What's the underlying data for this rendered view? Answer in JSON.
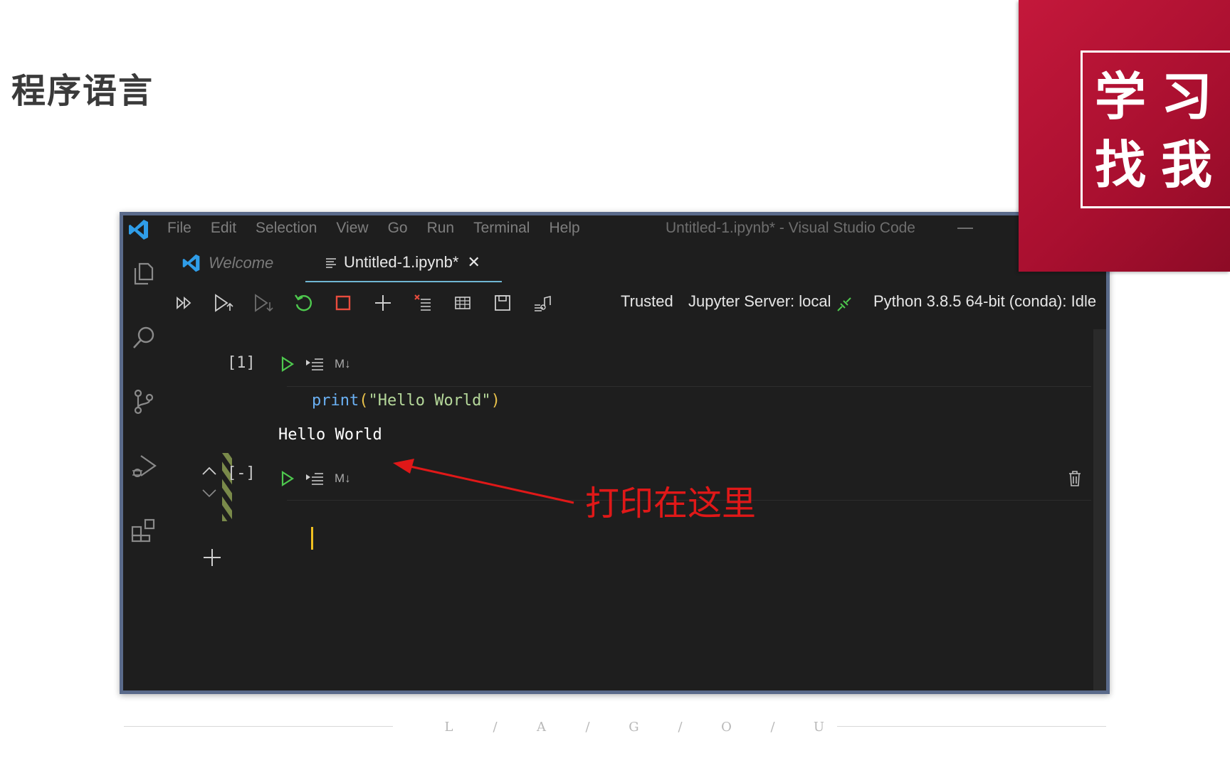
{
  "slide": {
    "title": "程序语言",
    "stamp": [
      "学",
      "习",
      "找",
      "我"
    ],
    "annotation": "打印在这里",
    "footer": [
      "L",
      "/",
      "A",
      "/",
      "G",
      "/",
      "O",
      "/",
      "U"
    ]
  },
  "window": {
    "menu": [
      "File",
      "Edit",
      "Selection",
      "View",
      "Go",
      "Run",
      "Terminal",
      "Help"
    ],
    "title": "Untitled-1.ipynb* - Visual Studio Code"
  },
  "tabs": {
    "welcome": "Welcome",
    "active": "Untitled-1.ipynb*",
    "close": "✕"
  },
  "toolbar": {
    "trusted": "Trusted",
    "server": "Jupyter Server: local",
    "kernel": "Python 3.8.5 64-bit (conda): Idle"
  },
  "cells": [
    {
      "count": "[1]",
      "md_label": "M↓",
      "code_func": "print",
      "code_open": "(",
      "code_str": "\"Hello World\"",
      "code_close": ")",
      "output": "Hello World"
    },
    {
      "count": "[-]",
      "md_label": "M↓"
    }
  ],
  "colors": {
    "accent_red": "#e01818",
    "stamp_red": "#b5123a",
    "run_green": "#4ec94e",
    "cursor": "#f0c020"
  }
}
